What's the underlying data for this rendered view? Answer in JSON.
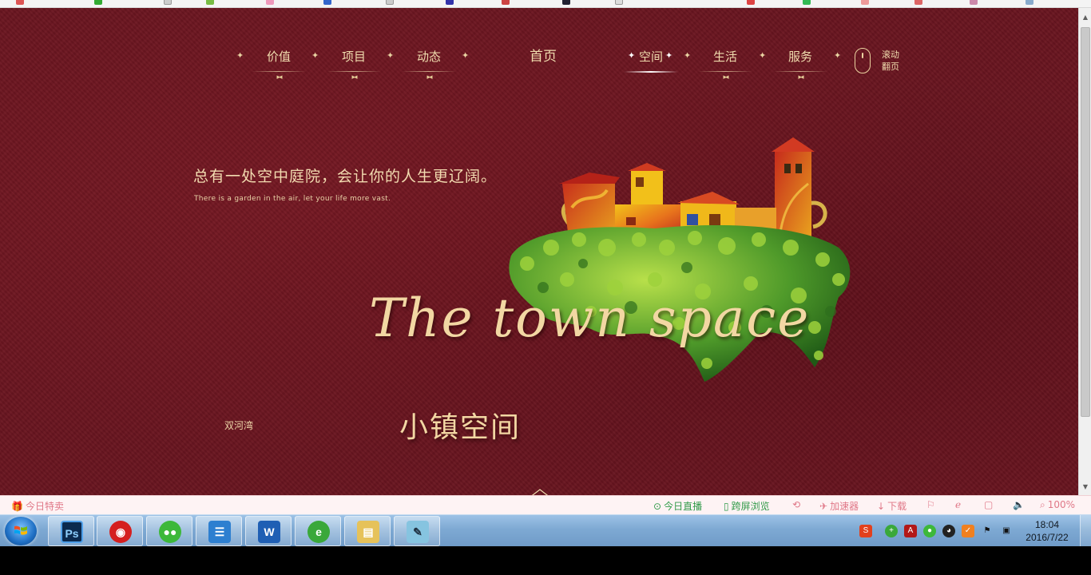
{
  "nav": {
    "left": [
      "价值",
      "项目",
      "动态"
    ],
    "home": "首页",
    "right": [
      "空间",
      "生活",
      "服务"
    ],
    "active": "空间",
    "scroll_hint": [
      "滚动",
      "翻页"
    ]
  },
  "hero": {
    "tagline_cn": "总有一处空中庭院，会让你的人生更辽阔。",
    "tagline_en": "There is a garden in the air, let your life more vast.",
    "script_title": "The town space",
    "place_name": "双河湾",
    "cn_title": "小镇空间"
  },
  "statusbar": {
    "left": "今日特卖",
    "live": "今日直播",
    "cross_screen": "跨屏浏览",
    "accelerator": "加速器",
    "download": "下载",
    "zoom": "100%"
  },
  "taskbar": {
    "apps": [
      "Ps",
      "W"
    ],
    "clock_time": "18:04",
    "clock_date": "2016/7/22"
  },
  "colors": {
    "page_bg": "#6a1520",
    "gold_text": "#f0dcae",
    "status_pink": "#e07888"
  }
}
